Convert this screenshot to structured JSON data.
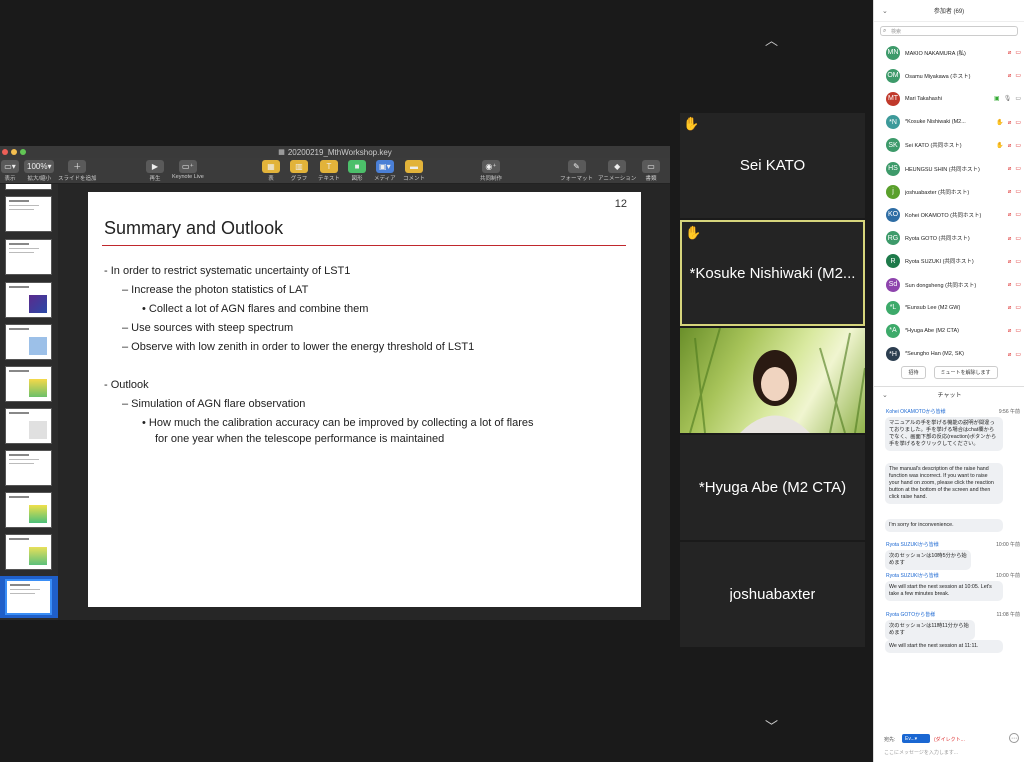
{
  "keynote": {
    "file_title": "20200219_MthWorkshop.key",
    "toolbar": [
      {
        "label": "表示",
        "icon": "view-icon"
      },
      {
        "label": "拡大/縮小",
        "value": "100%",
        "icon": "zoom-icon"
      },
      {
        "label": "スライドを追加",
        "icon": "plus-icon"
      },
      {
        "label": "再生",
        "icon": "play-icon"
      },
      {
        "label": "Keynote Live",
        "icon": "keynote-live-icon"
      },
      {
        "label": "表",
        "icon": "table-icon"
      },
      {
        "label": "グラフ",
        "icon": "chart-icon"
      },
      {
        "label": "テキスト",
        "icon": "text-icon"
      },
      {
        "label": "図形",
        "icon": "shape-icon"
      },
      {
        "label": "メディア",
        "icon": "media-icon"
      },
      {
        "label": "コメント",
        "icon": "comment-icon"
      },
      {
        "label": "共同制作",
        "icon": "collaborate-icon"
      },
      {
        "label": "フォーマット",
        "icon": "format-icon"
      },
      {
        "label": "アニメーション",
        "icon": "animate-icon"
      },
      {
        "label": "書類",
        "icon": "document-icon"
      }
    ],
    "slide": {
      "number": "12",
      "title": "Summary and Outlook",
      "bullets": [
        "-   In order to restrict systematic uncertainty of LST1",
        "–  Increase the photon statistics of LAT",
        "•  Collect a lot of AGN flares and combine them",
        "–  Use sources with steep spectrum",
        "–  Observe with low zenith in order to lower the energy threshold of LST1",
        "-   Outlook",
        "–  Simulation of AGN flare observation",
        "•  How much the calibration accuracy can be improved by collecting a lot of flares",
        "for one year when the telescope performance is maintained"
      ]
    }
  },
  "tiles": [
    {
      "name": "Sei KATO",
      "hand": "✋"
    },
    {
      "name": "*Kosuke Nishiwaki (M2...",
      "hand": "✋"
    },
    {
      "name": ""
    },
    {
      "name": "*Hyuga Abe (M2 CTA)"
    },
    {
      "name": "joshuabaxter"
    }
  ],
  "participants": {
    "title": "参加者 (69)",
    "search_placeholder": "検索",
    "list": [
      {
        "initials": "MN",
        "name": "MAKIO NAKAMURA (私)",
        "color": "#3d9a6a",
        "mic": "off",
        "cam": "off"
      },
      {
        "initials": "OM",
        "name": "Osamu Miyakawa (ホスト)",
        "color": "#3d9a6a",
        "mic": "off",
        "cam": "off"
      },
      {
        "initials": "MT",
        "name": "Mari Takahashi",
        "color": "#c0392b",
        "mic": "on",
        "cam": "on"
      },
      {
        "initials": "*N",
        "name": "*Kosuke Nishiwaki (M2...",
        "color": "#3d9a9a",
        "mic": "off",
        "cam": "off",
        "hand": true
      },
      {
        "initials": "SK",
        "name": "Sei KATO (共同ホスト)",
        "color": "#3d9a6a",
        "mic": "off",
        "cam": "off",
        "hand": true
      },
      {
        "initials": "HS",
        "name": "HEUNGSU SHIN (共同ホスト)",
        "color": "#3d9a6a",
        "mic": "off",
        "cam": "off"
      },
      {
        "initials": "j",
        "name": "joshuabaxter (共同ホスト)",
        "color": "#5aa02c",
        "mic": "off",
        "cam": "off"
      },
      {
        "initials": "KO",
        "name": "Kohei OKAMOTO (共同ホスト)",
        "color": "#2e6da4",
        "mic": "off",
        "cam": "off"
      },
      {
        "initials": "RG",
        "name": "Ryota GOTO (共同ホスト)",
        "color": "#3d9a6a",
        "mic": "off",
        "cam": "off"
      },
      {
        "initials": "R",
        "name": "Ryota SUZUKI (共同ホスト)",
        "color": "#1e7a4a",
        "mic": "off",
        "cam": "off"
      },
      {
        "initials": "Sd",
        "name": "Sun dongsheng (共同ホスト)",
        "color": "#8e44ad",
        "mic": "off",
        "cam": "off"
      },
      {
        "initials": "*L",
        "name": "*Eunsub Lee (M2 GW)",
        "color": "#3daa6a",
        "mic": "off",
        "cam": "off"
      },
      {
        "initials": "*A",
        "name": "*Hyuga Abe (M2 CTA)",
        "color": "#3daa6a",
        "mic": "off",
        "cam": "off"
      },
      {
        "initials": "*H",
        "name": "*Seungho Han (M2, SK)",
        "color": "#2c3e50",
        "mic": "off",
        "cam": "off"
      }
    ],
    "invite_label": "招待",
    "unmute_label": "ミュートを解除します"
  },
  "chat": {
    "title": "チャット",
    "messages": [
      {
        "from": "Kohei OKAMOTOから皆様",
        "time": "9:56 午前",
        "bubbles": [
          "マニュアルの手を挙げる機能の説明が間違っておりました。手を挙げる場合はchat欄からでなく、画面下部の反応(reaction)ボタンから手を挙げるをクリックしてください。",
          "The manual's description of the raise hand function was incorrect. If you want to raise your hand on zoom, please click the reaction button at the bottom of the screen and then click raise hand.",
          "I'm sorry for inconvenience."
        ]
      },
      {
        "from": "Ryota SUZUKIから皆様",
        "time": "10:00 午前",
        "bubbles": [
          "次のセッションは10時5分から始めます"
        ]
      },
      {
        "from": "Ryota SUZUKIから皆様",
        "time": "10:00 午前",
        "bubbles": [
          "We will start the next session at 10:05. Let's take a few minutes break."
        ]
      },
      {
        "from": "Ryota GOTOから皆様",
        "time": "11:08 午前",
        "bubbles": [
          "次のセッションは11時11分から始めます",
          "We will start the next session at 11:11."
        ]
      }
    ],
    "to_label": "宛先:",
    "to_value": "Ev...",
    "dm_label": "(ダイレクト...",
    "input_placeholder": "ここにメッセージを入力します..."
  }
}
